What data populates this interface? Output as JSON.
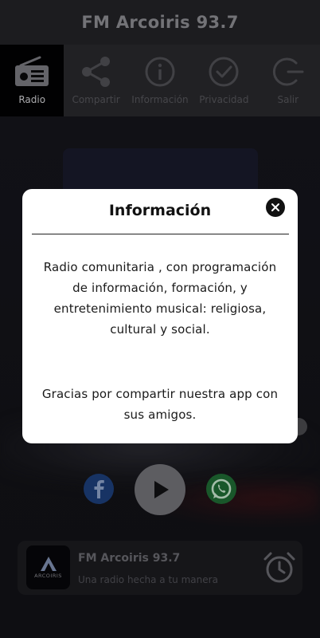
{
  "app": {
    "title": "FM Arcoiris 93.7"
  },
  "tabs": [
    {
      "label": "Radio",
      "icon": "radio-icon",
      "active": true
    },
    {
      "label": "Compartir",
      "icon": "share-icon",
      "active": false
    },
    {
      "label": "Información",
      "icon": "info-icon",
      "active": false
    },
    {
      "label": "Privacidad",
      "icon": "check-circle-icon",
      "active": false
    },
    {
      "label": "Salir",
      "icon": "exit-icon",
      "active": false
    }
  ],
  "now_playing": {
    "title": "FM Arcoiris 93.7",
    "subtitle": "Una radio hecha a tu manera",
    "logo_text": "ARCOIRIS"
  },
  "dialog": {
    "title": "Información",
    "paragraph1": "Radio comunitaria , con programación de información, formación, y entretenimiento musical: religiosa, cultural y social.",
    "paragraph2": "Gracias por compartir nuestra app con sus amigos."
  },
  "colors": {
    "facebook": "#1d3f7a",
    "whatsapp": "#1f6b34",
    "dialog_bg": "#ffffff",
    "active_tab_bg": "#020203"
  }
}
